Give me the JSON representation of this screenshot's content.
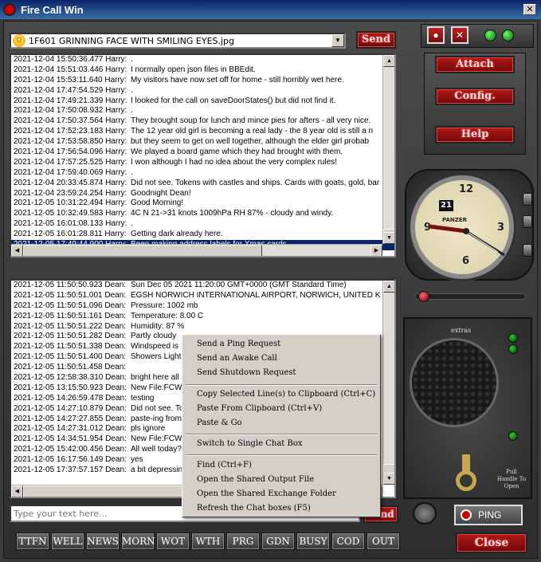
{
  "window": {
    "title": "Fire Call Win"
  },
  "toolbar": {
    "file_selected": "1F601 GRINNING FACE WITH SMILING EYES.jpg",
    "send_label": "Send",
    "attach_label": "Attach",
    "config_label": "Config.",
    "help_label": "Help",
    "close_label": "Close",
    "ping_label": "PING",
    "small_send_label": "Send"
  },
  "top_log": [
    {
      "ts": "2021-12-04 15:50:36.477 Harry:",
      "msg": "."
    },
    {
      "ts": "2021-12-04 15:51:03.446 Harry:",
      "msg": "I normally open json files in BBEdit."
    },
    {
      "ts": "2021-12-04 15:53:11.640 Harry:",
      "msg": "My visitors have now set off for home - still horribly wet here."
    },
    {
      "ts": "2021-12-04 17:47:54.529 Harry:",
      "msg": "."
    },
    {
      "ts": "2021-12-04 17:49:21.339 Harry:",
      "msg": "I looked for the call on saveDoorStates() but did not find it."
    },
    {
      "ts": "2021-12-04 17:50:08.932 Harry:",
      "msg": "."
    },
    {
      "ts": "2021-12-04 17:50:37.564 Harry:",
      "msg": "They brought soup for lunch and mince pies for afters - all very nice."
    },
    {
      "ts": "2021-12-04 17:52:23.183 Harry:",
      "msg": "The 12 year old girl is becoming a real lady - the 8 year old is still a n"
    },
    {
      "ts": "2021-12-04 17:53:58.850 Harry:",
      "msg": "but they seem to get on well together, although the elder girl probab"
    },
    {
      "ts": "2021-12-04 17:56:54.096 Harry:",
      "msg": "We played a board game which they had brought with them."
    },
    {
      "ts": "2021-12-04 17:57:25.525 Harry:",
      "msg": "I won although I had no idea about the very complex rules!"
    },
    {
      "ts": "2021-12-04 17:59:40.069 Harry:",
      "msg": "."
    },
    {
      "ts": "2021-12-04 20:33:45.874 Harry:",
      "msg": "Did not see. Tokens with castles and ships. Cards with goats, gold, bar"
    },
    {
      "ts": "2021-12-04 23:59:24.254 Harry:",
      "msg": "Goodnight Dean!"
    },
    {
      "ts": "2021-12-05 10:31:22.494 Harry:",
      "msg": "Good Morning!"
    },
    {
      "ts": "2021-12-05 10:32:49.583 Harry:",
      "msg": "4C N 21->31 knots 1009hPa RH 87% - cloudy and windy."
    },
    {
      "ts": "2021-12-05 16:01:08.133 Harry:",
      "msg": "."
    },
    {
      "ts": "2021-12-05 16:01:28.811 Harry:",
      "msg": "Getting dark already here."
    },
    {
      "ts": "2021-12-05 17:49:44.900 Harry:",
      "msg": "Been making address labels for Xmas cards."
    }
  ],
  "bottom_log": [
    {
      "ts": "2021-12-05 11:50:50.923 Dean:",
      "msg": "Sun Dec 05 2021 11:20:00 GMT+0000 (GMT Standard Time)"
    },
    {
      "ts": "2021-12-05 11:50:51.001 Dean:",
      "msg": "EGSH NORWICH INTERNATIONAL AIRPORT, NORWICH, UNITED K"
    },
    {
      "ts": "2021-12-05 11:50:51.096 Dean:",
      "msg": "Pressure: 1002 mb"
    },
    {
      "ts": "2021-12-05 11:50:51.161 Dean:",
      "msg": "Temperature: 8.00 C"
    },
    {
      "ts": "2021-12-05 11:50:51.222 Dean:",
      "msg": "Humidity: 87 %"
    },
    {
      "ts": "2021-12-05 11:50:51.282 Dean:",
      "msg": "Partly cloudy"
    },
    {
      "ts": "2021-12-05 11:50:51.338 Dean:",
      "msg": "Windspeed is 1"
    },
    {
      "ts": "2021-12-05 11:50:51.400 Dean:",
      "msg": "Showers Light"
    },
    {
      "ts": "2021-12-05 11:50:51.458 Dean:",
      "msg": ""
    },
    {
      "ts": "2021-12-05 12:58:38.310 Dean:",
      "msg": "bright here all d"
    },
    {
      "ts": "2021-12-05 13:15:50.923 Dean:",
      "msg": "New File:FCWF"
    },
    {
      "ts": "2021-12-05 14:26:59.478 Dean:",
      "msg": "testing"
    },
    {
      "ts": "2021-12-05 14:27:10.879 Dean:",
      "msg": "Did not see. Tok"
    },
    {
      "ts": "2021-12-05 14:27:27.855 Dean:",
      "msg": "paste-ing from"
    },
    {
      "ts": "2021-12-05 14:27:31.012 Dean:",
      "msg": "pls ignore"
    },
    {
      "ts": "2021-12-05 14:34:51.954 Dean:",
      "msg": "New File:FCWF"
    },
    {
      "ts": "2021-12-05 15:42:00.456 Dean:",
      "msg": "All well today?"
    },
    {
      "ts": "2021-12-05 16:17:56.149 Dean:",
      "msg": "yes"
    },
    {
      "ts": "2021-12-05 17:37:57.157 Dean:",
      "msg": "a bit depressing"
    }
  ],
  "input": {
    "placeholder": "Type your text here..."
  },
  "shortcuts": [
    "TTFN",
    "WELL",
    "NEWS",
    "MORN",
    "WOT",
    "WTH",
    "PRG",
    "GDN",
    "BUSY",
    "COD",
    "OUT"
  ],
  "context_menu": {
    "group1": [
      "Send a Ping Request",
      "Send an Awake Call",
      "Send Shutdown Request"
    ],
    "group2": [
      "Copy Selected Line(s) to Clipboard (Ctrl+C)",
      "Paste From Clipboard (Ctrl+V)",
      "Paste & Go"
    ],
    "group3": [
      "Switch to Single Chat Box"
    ],
    "group4": [
      "Find (Ctrl+F)",
      "Open the Shared Output File",
      "Open the Shared Exchange Folder",
      "Refresh the Chat boxes (F5)"
    ]
  },
  "clock": {
    "brand": "PANZER",
    "date": "21",
    "numerals": [
      "12",
      "3",
      "6",
      "9"
    ]
  },
  "speaker": {
    "extras_label": "extras",
    "pull_label": "Pull Handle To Open"
  }
}
